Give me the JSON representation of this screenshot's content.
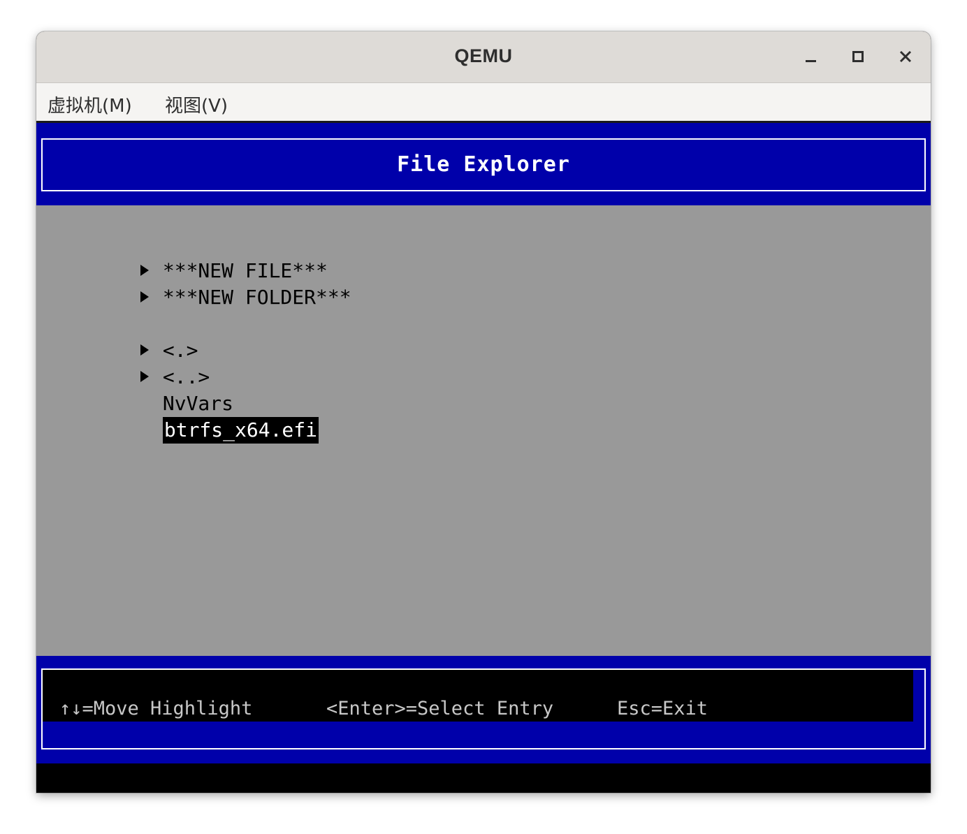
{
  "window": {
    "title": "QEMU"
  },
  "menubar": {
    "items": [
      {
        "label": "虚拟机(M)"
      },
      {
        "label": "视图(V)"
      }
    ]
  },
  "uefi": {
    "header_title": "File Explorer",
    "entries": [
      {
        "label": "***NEW FILE***",
        "arrow": true
      },
      {
        "label": "***NEW FOLDER***",
        "arrow": true
      },
      {
        "label": "<.>",
        "arrow": true
      },
      {
        "label": "<..>",
        "arrow": true
      },
      {
        "label": "NvVars",
        "arrow": false
      },
      {
        "label": "btrfs_x64.efi",
        "arrow": false,
        "selected": true
      }
    ],
    "help": {
      "move": "↑↓=Move Highlight",
      "select": "<Enter>=Select Entry",
      "exit": "Esc=Exit"
    }
  },
  "colors": {
    "uefi_blue": "#0000aa",
    "uefi_gray": "#999999",
    "titlebar": "#dedbd7"
  }
}
